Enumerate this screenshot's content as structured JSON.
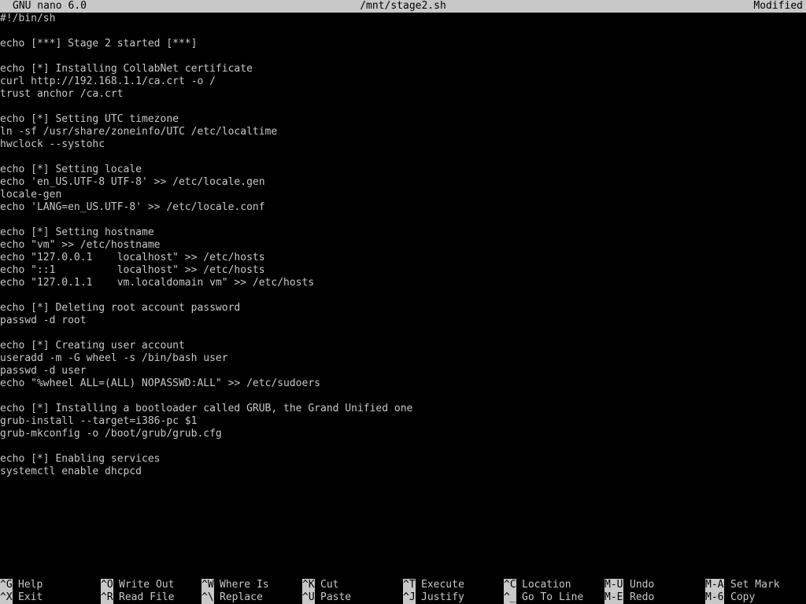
{
  "titlebar": {
    "app": "GNU nano 6.0",
    "file": "/mnt/stage2.sh",
    "status": "Modified"
  },
  "lines": [
    "#!/bin/sh",
    "",
    "echo [***] Stage 2 started [***]",
    "",
    "echo [*] Installing CollabNet certificate",
    "curl http://192.168.1.1/ca.crt -o /",
    "trust anchor /ca.crt",
    "",
    "echo [*] Setting UTC timezone",
    "ln -sf /usr/share/zoneinfo/UTC /etc/localtime",
    "hwclock --systohc",
    "",
    "echo [*] Setting locale",
    "echo 'en_US.UTF-8 UTF-8' >> /etc/locale.gen",
    "locale-gen",
    "echo 'LANG=en_US.UTF-8' >> /etc/locale.conf",
    "",
    "echo [*] Setting hostname",
    "echo \"vm\" >> /etc/hostname",
    "echo \"127.0.0.1    localhost\" >> /etc/hosts",
    "echo \"::1          localhost\" >> /etc/hosts",
    "echo \"127.0.1.1    vm.localdomain vm\" >> /etc/hosts",
    "",
    "echo [*] Deleting root account password",
    "passwd -d root",
    "",
    "echo [*] Creating user account",
    "useradd -m -G wheel -s /bin/bash user",
    "passwd -d user",
    "echo \"%wheel ALL=(ALL) NOPASSWD:ALL\" >> /etc/sudoers",
    "",
    "echo [*] Installing a bootloader called GRUB, the Grand Unified one",
    "grub-install --target=i386-pc $1",
    "grub-mkconfig -o /boot/grub/grub.cfg",
    "",
    "echo [*] Enabling services",
    "systemctl enable dhcpcd"
  ],
  "shortcuts": {
    "row1": [
      {
        "key": "^G",
        "label": "Help"
      },
      {
        "key": "^O",
        "label": "Write Out"
      },
      {
        "key": "^W",
        "label": "Where Is"
      },
      {
        "key": "^K",
        "label": "Cut"
      },
      {
        "key": "^T",
        "label": "Execute"
      },
      {
        "key": "^C",
        "label": "Location"
      },
      {
        "key": "M-U",
        "label": "Undo"
      },
      {
        "key": "M-A",
        "label": "Set Mark"
      }
    ],
    "row2": [
      {
        "key": "^X",
        "label": "Exit"
      },
      {
        "key": "^R",
        "label": "Read File"
      },
      {
        "key": "^\\",
        "label": "Replace"
      },
      {
        "key": "^U",
        "label": "Paste"
      },
      {
        "key": "^J",
        "label": "Justify"
      },
      {
        "key": "^_",
        "label": "Go To Line"
      },
      {
        "key": "M-E",
        "label": "Redo"
      },
      {
        "key": "M-6",
        "label": "Copy"
      }
    ]
  },
  "colors": {
    "background": "#000000",
    "foreground": "#c8c8c8",
    "inverse_background": "#c8c8c8",
    "inverse_foreground": "#000000"
  }
}
